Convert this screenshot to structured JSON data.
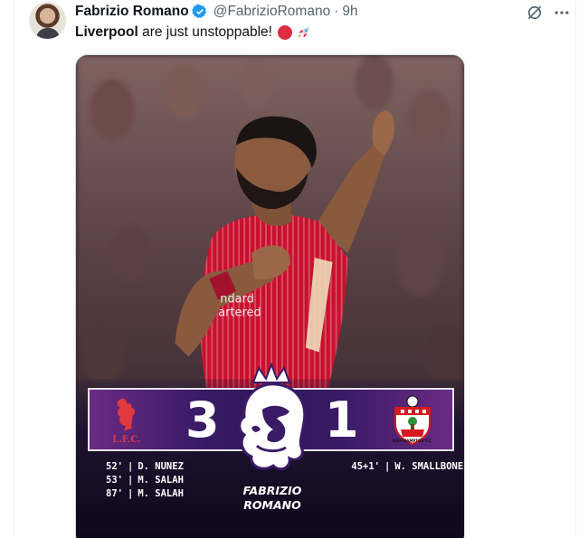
{
  "author": {
    "display_name": "Fabrizio Romano",
    "handle": "@FabrizioRomano",
    "separator": "·",
    "time": "9h"
  },
  "tweet": {
    "team": "Liverpool",
    "text": " are just unstoppable!"
  },
  "icons": {
    "verified": "verified-badge-icon",
    "grok": "grok-icon",
    "more": "more-options-icon",
    "emoji_1": "red-circle-emoji",
    "emoji_2": "rocket-emoji"
  },
  "colors": {
    "accent": "#1d9bf0",
    "text": "#0f1419",
    "secondary": "#536471",
    "band_purple": "#3a1b66",
    "liverpool_red": "#c8102e"
  },
  "media": {
    "score": {
      "home_goals": "3",
      "away_goals": "1",
      "home_crest_text": "L.F.C.",
      "away_crest_text": "SOUTHAMPTON F.C."
    },
    "home_scorers": [
      {
        "minute": "52'",
        "sep": "|",
        "name": "D. NUNEZ"
      },
      {
        "minute": "53'",
        "sep": "|",
        "name": "M. SALAH"
      },
      {
        "minute": "87'",
        "sep": "|",
        "name": "M. SALAH"
      }
    ],
    "away_scorers": [
      {
        "minute": "45+1'",
        "sep": "|",
        "name": "W. SMALLBONE"
      }
    ],
    "signature": {
      "line1": "FABRIZIO",
      "line2": "ROMANO"
    },
    "shirt_sponsor": {
      "line1": "ndard",
      "line2": "artered"
    }
  }
}
